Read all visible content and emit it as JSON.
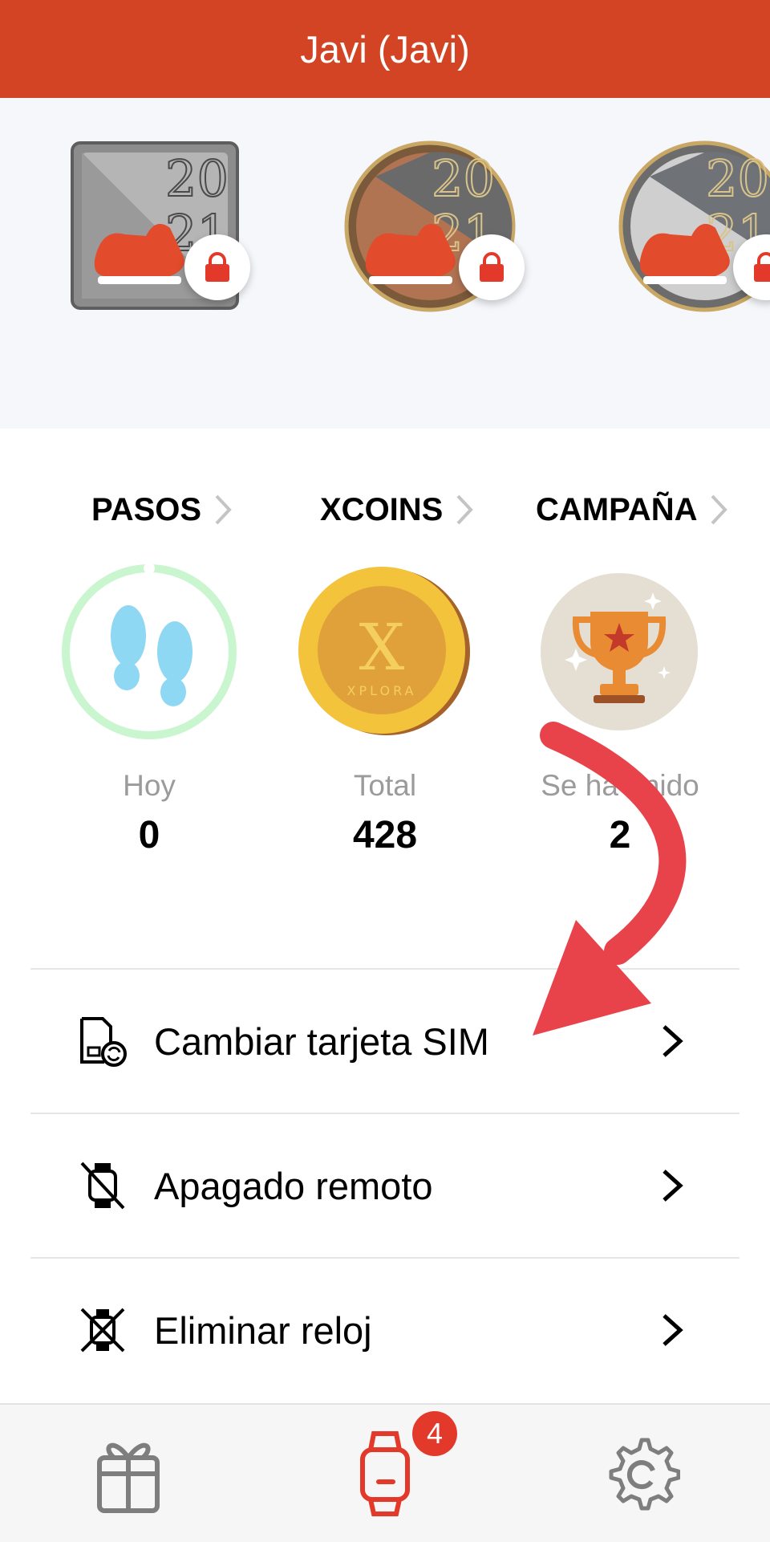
{
  "header": {
    "title": "Javi (Javi)"
  },
  "badges": [
    {
      "name": "Silver 2021 walking badge",
      "locked": true,
      "shape": "square"
    },
    {
      "name": "Bronze 2021 walking badge",
      "locked": true,
      "shape": "round"
    },
    {
      "name": "Silver 2021 walking badge",
      "locked": true,
      "shape": "round"
    }
  ],
  "stats": [
    {
      "heading": "PASOS",
      "label": "Hoy",
      "value": "0",
      "icon": "footsteps-icon"
    },
    {
      "heading": "XCOINS",
      "label": "Total",
      "value": "428",
      "icon": "xcoin-icon",
      "coin_text": "XPLORA"
    },
    {
      "heading": "CAMPAÑA",
      "label": "Se ha unido",
      "value": "2",
      "icon": "trophy-icon"
    }
  ],
  "menu": [
    {
      "label": "Cambiar tarjeta SIM",
      "icon": "sim-card-refresh-icon"
    },
    {
      "label": "Apagado remoto",
      "icon": "watch-off-icon"
    },
    {
      "label": "Eliminar reloj",
      "icon": "watch-delete-icon"
    }
  ],
  "tabbar": {
    "tabs": [
      {
        "name": "gift-icon",
        "active": false
      },
      {
        "name": "watch-icon",
        "active": true
      },
      {
        "name": "settings-icon",
        "active": false
      }
    ],
    "badge_count": "4"
  },
  "colors": {
    "brand": "#d24423",
    "lock": "#e2392b",
    "annotation_arrow": "#e8424b",
    "steps_ring": "#c9f5cf",
    "coin": "#f2c33b"
  }
}
